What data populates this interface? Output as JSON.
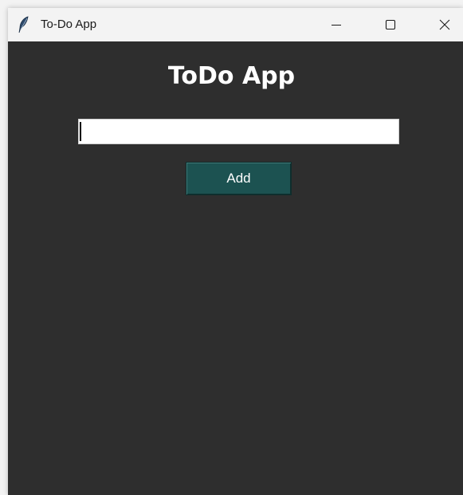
{
  "window": {
    "title": "To-Do App",
    "icon": "feather-icon",
    "controls": [
      "minimize-icon",
      "maximize-icon",
      "close-icon"
    ]
  },
  "main": {
    "heading": "ToDo App",
    "task_input": {
      "value": "",
      "placeholder": ""
    },
    "add_label": "Add"
  },
  "colors": {
    "background": "#2e2e2e",
    "button": "#1c5251",
    "heading_text": "#ffffff"
  }
}
